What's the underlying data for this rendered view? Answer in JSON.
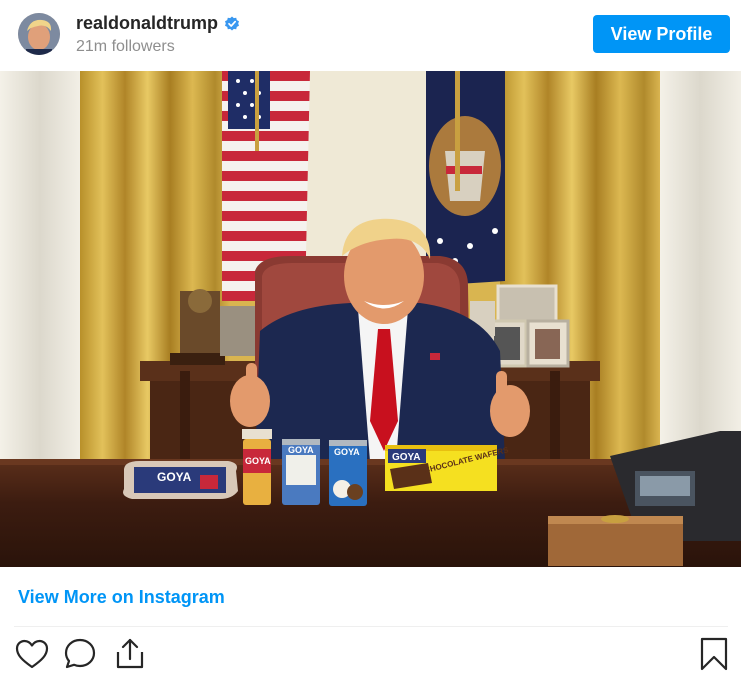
{
  "header": {
    "username": "realdonaldtrump",
    "followers": "21m followers",
    "verified": true,
    "view_profile_label": "View Profile"
  },
  "photo": {
    "products": {
      "beans_bag": "GOYA",
      "adobo_jar": "GOYA",
      "can_white": "GOYA",
      "can_coconut": "GOYA",
      "wafers_box": "GOYA",
      "wafers_text": "CHOCOLATE WAFERS"
    }
  },
  "footer": {
    "view_more_label": "View More on Instagram"
  },
  "icons": [
    "heart-icon",
    "comment-icon",
    "share-icon",
    "bookmark-icon",
    "verified-badge-icon"
  ],
  "colors": {
    "accent": "#0095f6",
    "text": "#262626",
    "muted": "#8e8e8e"
  }
}
